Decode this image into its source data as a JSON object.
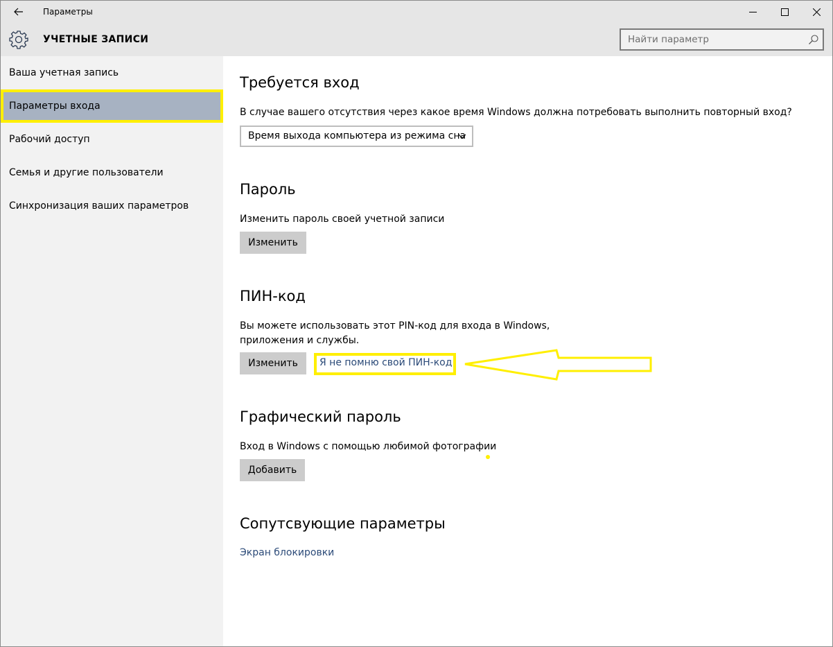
{
  "window": {
    "app_title": "Параметры",
    "section_title": "УЧЕТНЫЕ ЗАПИСИ"
  },
  "search": {
    "placeholder": "Найти параметр"
  },
  "sidebar": {
    "items": [
      {
        "label": "Ваша учетная запись",
        "selected": false
      },
      {
        "label": "Параметры входа",
        "selected": true
      },
      {
        "label": "Рабочий доступ",
        "selected": false
      },
      {
        "label": "Семья и другие пользователи",
        "selected": false
      },
      {
        "label": "Синхронизация ваших параметров",
        "selected": false
      }
    ]
  },
  "main": {
    "signin_required": {
      "heading": "Требуется вход",
      "description": "В случае вашего отсутствия через какое время Windows должна потребовать выполнить повторный вход?",
      "dropdown_value": "Время выхода компьютера из режима сна"
    },
    "password": {
      "heading": "Пароль",
      "description": "Изменить пароль своей учетной записи",
      "button": "Изменить"
    },
    "pin": {
      "heading": "ПИН-код",
      "description_line1": "Вы можете использовать этот PIN-код для входа в Windows,",
      "description_line2": "приложения и службы.",
      "button": "Изменить",
      "forgot_link": "Я не помню свой ПИН-код"
    },
    "picture_password": {
      "heading": "Графический пароль",
      "description": "Вход в Windows с помощью любимой фотографии",
      "button": "Добавить"
    },
    "related": {
      "heading": "Сопутсвующие параметры",
      "link": "Экран блокировки"
    }
  },
  "colors": {
    "titlebar_bg": "#e6e6e6",
    "sidebar_bg": "#f2f2f2",
    "selected_bg": "#a7b2c2",
    "highlight": "#ffef00",
    "link": "#2b4a78",
    "button_bg": "#cccccc"
  },
  "icons": {
    "back": "arrow-left-icon",
    "settings": "gear-icon",
    "search": "search-icon",
    "minimize": "minimize-icon",
    "maximize": "maximize-icon",
    "close": "close-icon",
    "dropdown": "chevron-down-icon"
  }
}
